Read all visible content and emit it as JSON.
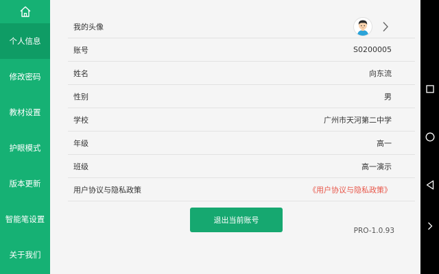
{
  "sidebar": {
    "home_icon": "home-icon",
    "items": [
      {
        "label": "个人信息",
        "active": true
      },
      {
        "label": "修改密码"
      },
      {
        "label": "教材设置"
      },
      {
        "label": "护眼模式"
      },
      {
        "label": "版本更新"
      },
      {
        "label": "智能笔设置"
      },
      {
        "label": "关于我们"
      }
    ]
  },
  "profile": {
    "rows": [
      {
        "label": "我的头像",
        "value": "",
        "icon": "avatar-boy-icon"
      },
      {
        "label": "账号",
        "value": "S0200005"
      },
      {
        "label": "姓名",
        "value": "向东流"
      },
      {
        "label": "性别",
        "value": "男"
      },
      {
        "label": "学校",
        "value": "广州市天河第二中学"
      },
      {
        "label": "年级",
        "value": "高一"
      },
      {
        "label": "班级",
        "value": "高一演示"
      },
      {
        "label": "用户协议与隐私政策",
        "value": "《用户协议与隐私政策》"
      }
    ]
  },
  "logout_label": "退出当前账号",
  "version": "PRO-1.0.93",
  "colors": {
    "sidebar": "#16b174",
    "sidebar_active": "#0f9c65",
    "button": "#16a870",
    "link": "#e8574a"
  },
  "system_nav": [
    "square-icon",
    "circle-icon",
    "back-triangle-icon",
    "chevron-right-icon"
  ]
}
